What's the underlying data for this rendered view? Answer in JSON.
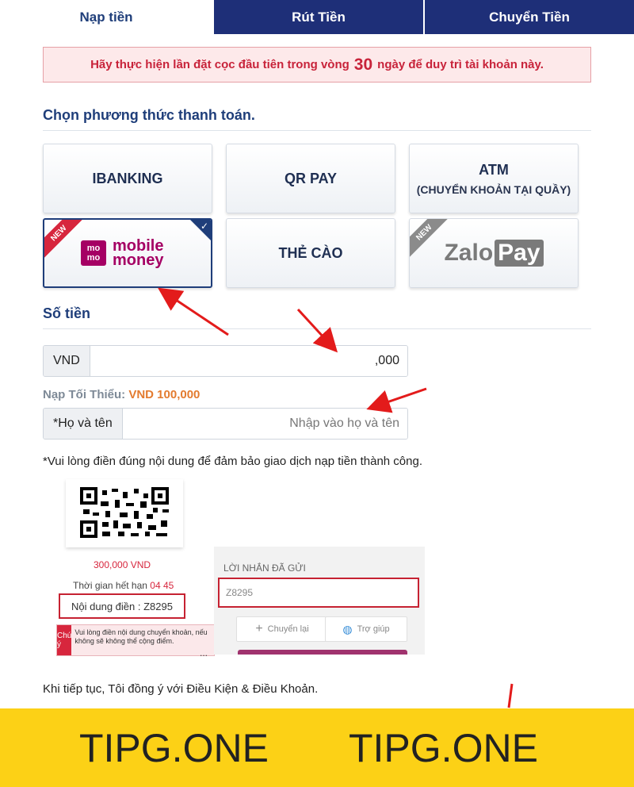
{
  "tabs": [
    {
      "label": "Nạp tiền",
      "active": true
    },
    {
      "label": "Rút Tiền",
      "active": false
    },
    {
      "label": "Chuyển Tiền",
      "active": false
    }
  ],
  "notice": {
    "before": "Hãy thực hiện lần đặt cọc đầu tiên trong vòng",
    "days": "30",
    "after": "ngày để duy trì tài khoản này."
  },
  "payment_section": {
    "title": "Chọn phương thức thanh toán.",
    "methods": [
      {
        "label": "IBANKING"
      },
      {
        "label": "QR PAY"
      },
      {
        "label": "ATM",
        "sub": "(CHUYỂN KHOẢN TẠI QUẦY)"
      },
      {
        "label": "mobile money",
        "logo_text": "mo mo",
        "badge": "NEW",
        "selected": true
      },
      {
        "label": "THẺ CÀO"
      },
      {
        "label": "ZaloPay",
        "zalo": "Zalo",
        "pay": "Pay",
        "badge": "NEW"
      }
    ]
  },
  "amount_section": {
    "title": "Số tiền",
    "currency": "VND",
    "value": ",000",
    "min_label": "Nạp Tối Thiểu:",
    "min_value": "VND 100,000",
    "name_label": "*Họ và tên",
    "name_placeholder": "Nhập vào họ và tên",
    "note": "*Vui lòng điền đúng nội dung để đảm bảo giao dịch nạp tiền thành công."
  },
  "embedded": {
    "amount": "300,000 VND",
    "expire_label": "Thời gian hết hạn",
    "expire_value": "04 45",
    "content_label": "Nội dung điền : Z8295",
    "warn_tag": "Chú ý",
    "warn_text": "Vui lòng điền nội dung chuyển khoản, nếu không sẽ không thể cộng điểm.",
    "dots": "...",
    "chat_title": "LỜI NHẮN ĐÃ GỬI",
    "chat_value": "Z8295",
    "btn_resend": "Chuyển lại",
    "btn_help": "Trợ giúp"
  },
  "terms": "Khi tiếp tục, Tôi đồng ý với Điều Kiện & Điều Khoản.",
  "watermark": {
    "left": "TIPG.ONE",
    "right": "TIPG.ONE"
  },
  "colors": {
    "navy": "#1e2f78",
    "accent_red": "#d7263d",
    "footer_yellow": "#fcd116",
    "momo": "#a50064"
  }
}
